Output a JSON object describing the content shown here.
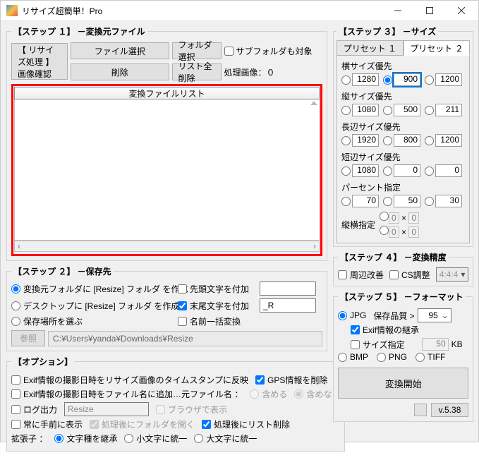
{
  "window": {
    "title": "リサイズ超簡単！Pro"
  },
  "step1": {
    "legend": "【ステップ １】 －変換元ファイル",
    "file_select": "ファイル選択",
    "delete": "削除",
    "resize_process": "【 リサイズ処理 】画像確認",
    "folder_select": "フォルダ選択",
    "list_all_delete": "リスト全削除",
    "subfolder": "サブフォルダも対象",
    "processing_label": "処理画像：",
    "processing_count": "０",
    "filelist_header": "変換ファイルリスト"
  },
  "step2": {
    "legend": "【ステップ ２】 －保存先",
    "opt_same_folder": "変換元フォルダに [Resize] フォルダ を作成",
    "opt_desktop": "デスクトップに [Resize] フォルダ を作成",
    "opt_choose": "保存場所を選ぶ",
    "chk_prefix": "先頭文字を付加",
    "chk_suffix": "末尾文字を付加",
    "suffix_value": "_R",
    "chk_rename": "名前一括変換",
    "browse": "参照",
    "path": "C:¥Users¥yanda¥Downloads¥Resize"
  },
  "options": {
    "legend": "【オプション】",
    "exif_timestamp": "Exif情報の撮影日時をリサイズ画像のタイムスタンプに反映",
    "gps_delete": "GPS情報を削除",
    "exif_filename": "Exif情報の撮影日時をファイル名に追加…元ファイル名 ：",
    "include": "含める",
    "exclude": "含めない",
    "log_output": "ログ出力",
    "log_value": "Resize",
    "browser_show": "ブラウザで表示",
    "always_front": "常に手前に表示",
    "open_folder": "処理後にフォルダを開く",
    "clear_list": "処理後にリスト削除",
    "ext_label": "拡張子 ：",
    "ext_inherit": "文字種を継承",
    "ext_lower": "小文字に統一",
    "ext_upper": "大文字に統一"
  },
  "step3": {
    "legend": "【ステップ ３】 －サイズ",
    "tab1": "プリセット １",
    "tab2": "プリセット ２",
    "width_priority": "横サイズ優先",
    "width_vals": [
      "1280",
      "900",
      "1200"
    ],
    "height_priority": "縦サイズ優先",
    "height_vals": [
      "1080",
      "500",
      "211"
    ],
    "long_priority": "長辺サイズ優先",
    "long_vals": [
      "1920",
      "800",
      "1200"
    ],
    "short_priority": "短辺サイズ優先",
    "short_vals": [
      "1080",
      "0",
      "0"
    ],
    "percent": "パーセント指定",
    "percent_vals": [
      "70",
      "50",
      "30"
    ],
    "aspect": "縦横指定",
    "aspect_vals": [
      "0",
      "0",
      "0",
      "0"
    ]
  },
  "step4": {
    "legend": "【ステップ ４】 －変換精度",
    "edge": "周辺改善",
    "cs": "CS調整",
    "csval": "4:4:4"
  },
  "step5": {
    "legend": "【ステップ ５】 －フォーマット",
    "jpg": "JPG",
    "quality_label": "保存品質 >",
    "quality_val": "95",
    "exif_inherit": "Exif情報の継承",
    "size_specify": "サイズ指定",
    "size_val": "50",
    "size_unit": "KB",
    "bmp": "BMP",
    "png": "PNG",
    "tiff": "TIFF",
    "start": "変換開始"
  },
  "version": "v.5.38"
}
